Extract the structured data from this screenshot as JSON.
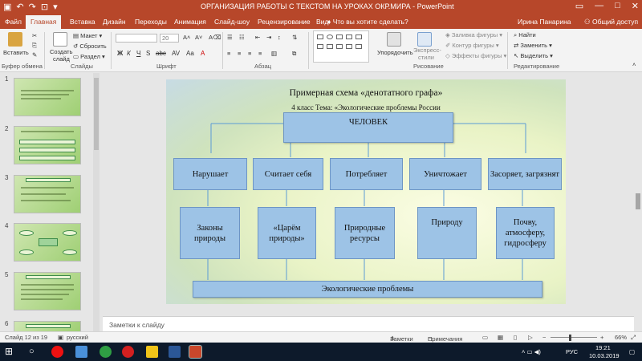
{
  "window": {
    "title": "ОРГАНИЗАЦИЯ РАБОТЫ С ТЕКСТОМ НА УРОКАХ ОКР.МИРА - PowerPoint",
    "qat_icons": [
      "save-icon",
      "undo-icon",
      "redo-icon",
      "start-icon"
    ]
  },
  "tabs": [
    "Файл",
    "Главная",
    "Вставка",
    "Дизайн",
    "Переходы",
    "Анимация",
    "Слайд-шоу",
    "Рецензирование",
    "Вид"
  ],
  "tellme": "Что вы хотите сделать?",
  "user": "Ирина Панарина",
  "share": "Общий доступ",
  "ribbon": {
    "clipboard": {
      "paste": "Вставить",
      "cut": "",
      "copy": "",
      "label": "Буфер обмена"
    },
    "slides": {
      "create": "Создать",
      "create2": "слайд",
      "layout": "Макет",
      "reset": "Сбросить",
      "section": "Раздел",
      "label": "Слайды"
    },
    "font": {
      "size": "20",
      "label": "Шрифт"
    },
    "paragraph": {
      "label": "Абзац"
    },
    "drawing": {
      "arrange": "Упорядочить",
      "styles": "Экспресс-",
      "styles2": "стили",
      "fill": "Заливка фигуры",
      "outline": "Контур фигуры",
      "effects": "Эффекты фигуры",
      "label": "Рисование"
    },
    "editing": {
      "find": "Найти",
      "replace": "Заменить",
      "select": "Выделить",
      "label": "Редактирование"
    }
  },
  "slide_panel": {
    "numbers": [
      "1",
      "2",
      "3",
      "4",
      "5",
      "6"
    ]
  },
  "slide": {
    "title": "Примерная схема «денотатного графа»",
    "subtitle": "4 класс Тема: «Экологические проблемы России",
    "top_node": "ЧЕЛОВЕК",
    "verbs": [
      "Нарушает",
      "Считает себя",
      "Потребляет",
      "Уничтожает",
      "Засоряет, загрязнят"
    ],
    "objects": [
      "Законы природы",
      "«Царём природы»",
      "Природные ресурсы",
      "Природу",
      "Почву, атмосферу, гидросферу"
    ],
    "bottom_node": "Экологические проблемы"
  },
  "notes": "Заметки к слайду",
  "status": {
    "slide": "Слайд 12 из 19",
    "lang": "русский",
    "notes_btn": "Заметки",
    "comments_btn": "Примечания",
    "zoom": "66%"
  },
  "taskbar": {
    "lang": "РУС",
    "time": "19:21",
    "date": "10.03.2019"
  },
  "colors": {
    "accent": "#b7472a",
    "node_fill": "#9dc3e6",
    "node_border": "#6d95c4"
  }
}
